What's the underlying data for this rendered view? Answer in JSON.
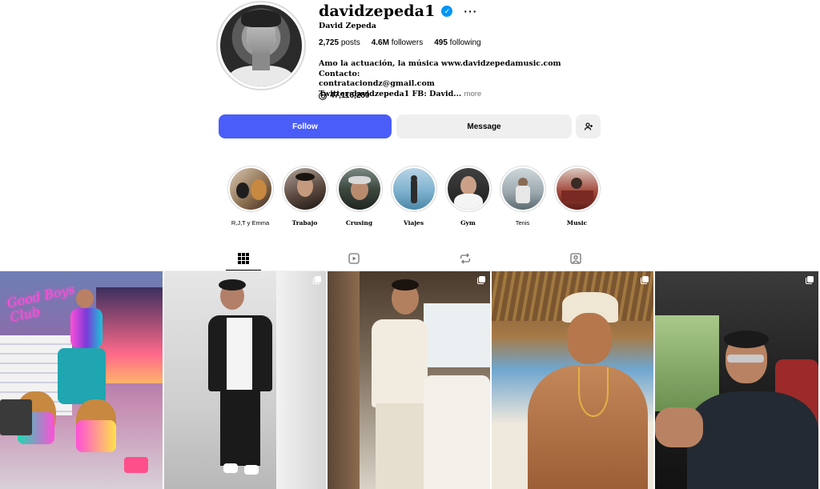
{
  "profile": {
    "username": "davidzepeda1",
    "full_name": "David Zepeda",
    "verified": true,
    "stats": {
      "posts_count": "2,725",
      "posts_label": "posts",
      "followers_count": "4.6M",
      "followers_label": "followers",
      "following_count": "495",
      "following_label": "following"
    },
    "bio_line1": "Amo la actuación, la música www.davidzepedamusic.com Contacto:",
    "bio_line2": "contrataciondz@gmail.com",
    "bio_line3": "Twitter:davidzepeda1 FB: David...",
    "bio_more": "more",
    "threads_count": "47,116,280"
  },
  "actions": {
    "follow_label": "Follow",
    "message_label": "Message",
    "suggest_icon": "add-user-icon"
  },
  "highlights": [
    {
      "label": "R,J,T y Emma",
      "bold": false
    },
    {
      "label": "Trabajo",
      "bold": true
    },
    {
      "label": "Crusing",
      "bold": true
    },
    {
      "label": "Viajes",
      "bold": true
    },
    {
      "label": "Gym",
      "bold": true
    },
    {
      "label": "Tenis",
      "bold": false
    },
    {
      "label": "Music",
      "bold": true
    }
  ],
  "tabs": [
    {
      "icon": "grid-icon",
      "active": true
    },
    {
      "icon": "reels-icon",
      "active": false
    },
    {
      "icon": "reposts-icon",
      "active": false
    },
    {
      "icon": "tagged-icon",
      "active": false
    }
  ],
  "posts": [
    {
      "text": "Good Boys Club",
      "multi": false
    },
    {
      "multi": true
    },
    {
      "multi": true
    },
    {
      "multi": true
    },
    {
      "multi": true
    }
  ],
  "colors": {
    "follow_button": "#4a5df9",
    "secondary_button": "#efefef",
    "verified_badge": "#0095f6",
    "muted_text": "#737373",
    "neon_sign": "#ff4fd8"
  }
}
